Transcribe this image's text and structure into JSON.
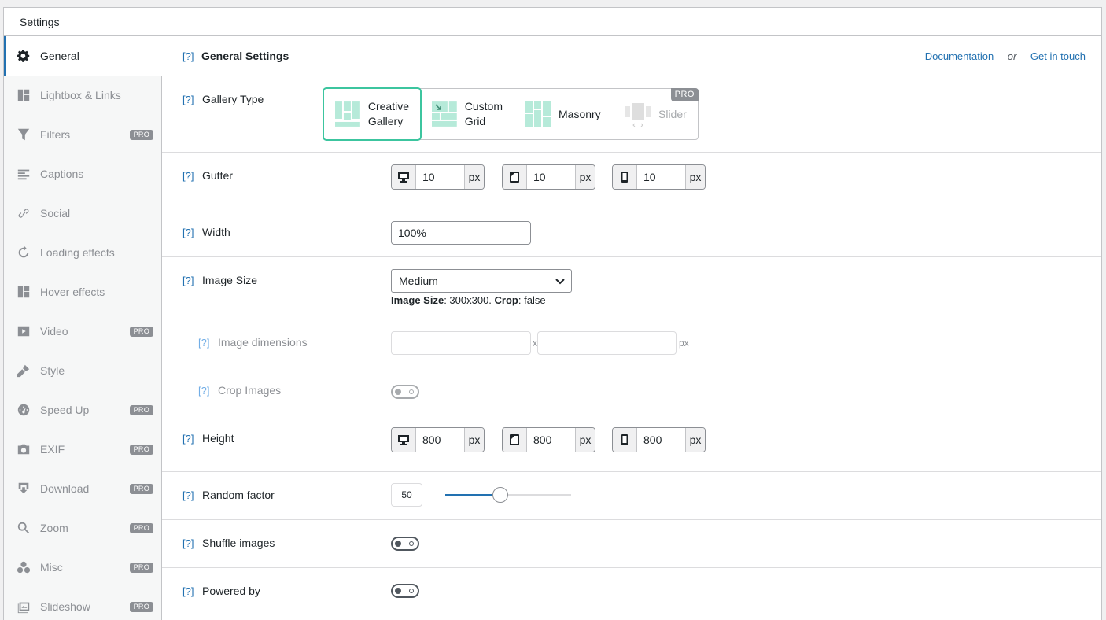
{
  "header": {
    "title": "Settings"
  },
  "sidebar": {
    "items": [
      {
        "label": "General",
        "icon": "gear-icon",
        "pro": false
      },
      {
        "label": "Lightbox & Links",
        "icon": "lightbox-icon",
        "pro": false
      },
      {
        "label": "Filters",
        "icon": "filter-icon",
        "pro": true
      },
      {
        "label": "Captions",
        "icon": "captions-icon",
        "pro": false
      },
      {
        "label": "Social",
        "icon": "link-icon",
        "pro": false
      },
      {
        "label": "Loading effects",
        "icon": "refresh-icon",
        "pro": false
      },
      {
        "label": "Hover effects",
        "icon": "grid-icon",
        "pro": false
      },
      {
        "label": "Video",
        "icon": "video-icon",
        "pro": true
      },
      {
        "label": "Style",
        "icon": "brush-icon",
        "pro": false
      },
      {
        "label": "Speed Up",
        "icon": "dashboard-icon",
        "pro": true
      },
      {
        "label": "EXIF",
        "icon": "camera-icon",
        "pro": true
      },
      {
        "label": "Download",
        "icon": "download-icon",
        "pro": true
      },
      {
        "label": "Zoom",
        "icon": "zoom-icon",
        "pro": true
      },
      {
        "label": "Misc",
        "icon": "misc-icon",
        "pro": true
      },
      {
        "label": "Slideshow",
        "icon": "slideshow-icon",
        "pro": true
      }
    ],
    "pro_label": "PRO"
  },
  "main": {
    "help_label": "[?]",
    "title": "General Settings",
    "doc_link": "Documentation",
    "or_text": "- or -",
    "contact_link": "Get in touch"
  },
  "gallery_type": {
    "label": "Gallery Type",
    "options": [
      {
        "line1": "Creative",
        "line2": "Gallery",
        "selected": true,
        "disabled": false
      },
      {
        "line1": "Custom",
        "line2": "Grid",
        "selected": false,
        "disabled": false
      },
      {
        "line1": "Masonry",
        "line2": "",
        "selected": false,
        "disabled": false
      },
      {
        "line1": "Slider",
        "line2": "",
        "selected": false,
        "disabled": true
      }
    ],
    "pro_label": "PRO"
  },
  "gutter": {
    "label": "Gutter",
    "desktop": "10",
    "tablet": "10",
    "mobile": "10",
    "unit": "px"
  },
  "width": {
    "label": "Width",
    "value": "100%"
  },
  "image_size": {
    "label": "Image Size",
    "selected": "Medium",
    "note_label": "Image Size",
    "note_value": ": 300x300. ",
    "crop_label": "Crop",
    "crop_value": ": false"
  },
  "image_dimensions": {
    "label": "Image dimensions",
    "separator": "x",
    "unit": "px"
  },
  "crop_images": {
    "label": "Crop Images"
  },
  "height": {
    "label": "Height",
    "desktop": "800",
    "tablet": "800",
    "mobile": "800",
    "unit": "px"
  },
  "random_factor": {
    "label": "Random factor",
    "value": "50",
    "slider_fraction": 0.44
  },
  "shuffle_images": {
    "label": "Shuffle images"
  },
  "powered_by": {
    "label": "Powered by"
  },
  "colors": {
    "accent": "#2271b1",
    "gallery_green": "#3cc59f",
    "pro_badge": "#8c8f94"
  }
}
